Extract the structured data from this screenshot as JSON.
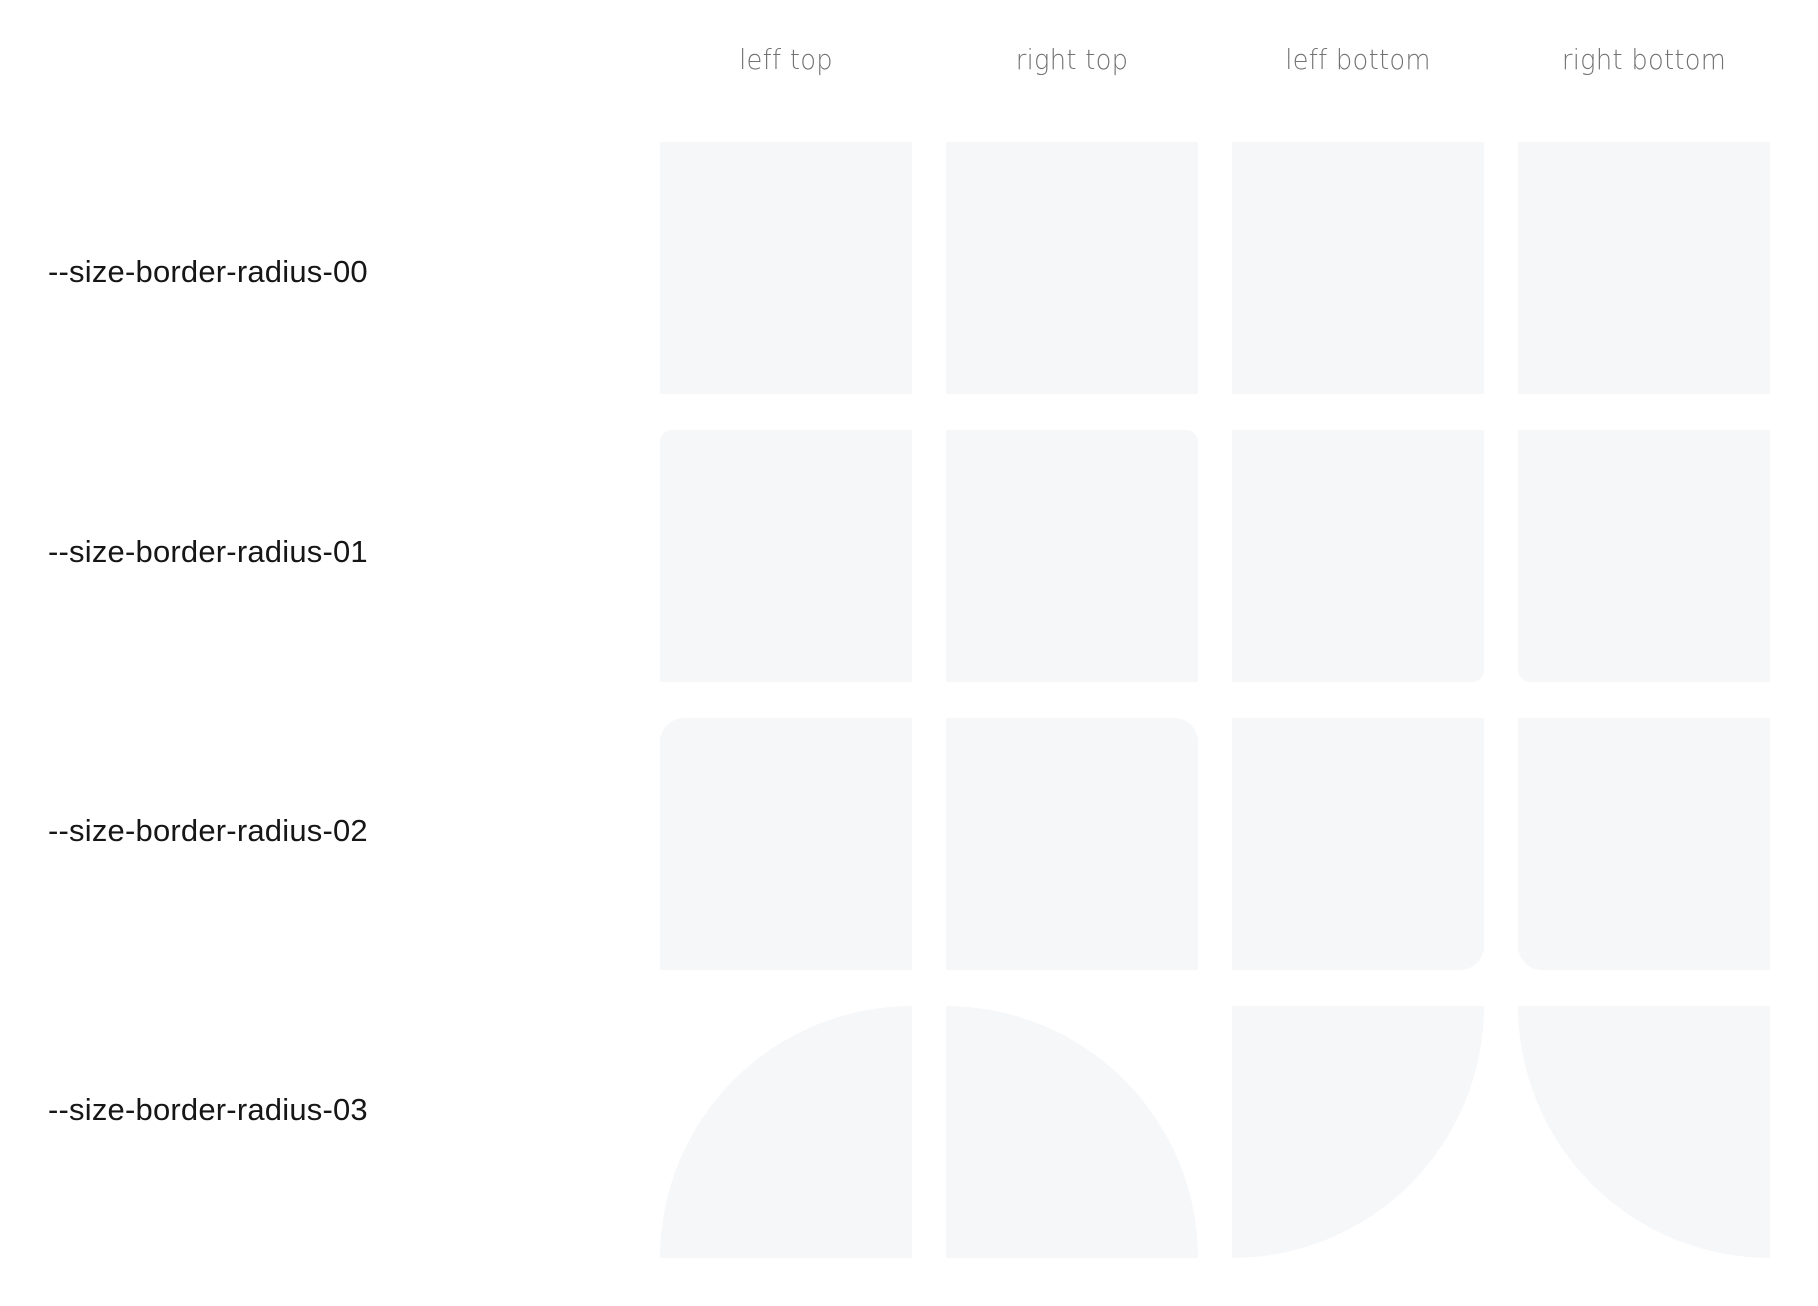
{
  "columns": [
    {
      "label": "leff top",
      "corner": "top-left"
    },
    {
      "label": "right top",
      "corner": "top-right"
    },
    {
      "label": "leff bottom",
      "corner": "bottom-left"
    },
    {
      "label": "right bottom",
      "corner": "bottom-right"
    }
  ],
  "rows": [
    {
      "label": "--size-border-radius-00",
      "token": "00"
    },
    {
      "label": "--size-border-radius-01",
      "token": "01"
    },
    {
      "label": "--size-border-radius-02",
      "token": "02"
    },
    {
      "label": "--size-border-radius-03",
      "token": "03"
    }
  ],
  "colors": {
    "swatch": "#f6f7f9",
    "label_text": "#161616",
    "header_text": "#5a5a5a",
    "background": "#ffffff"
  }
}
